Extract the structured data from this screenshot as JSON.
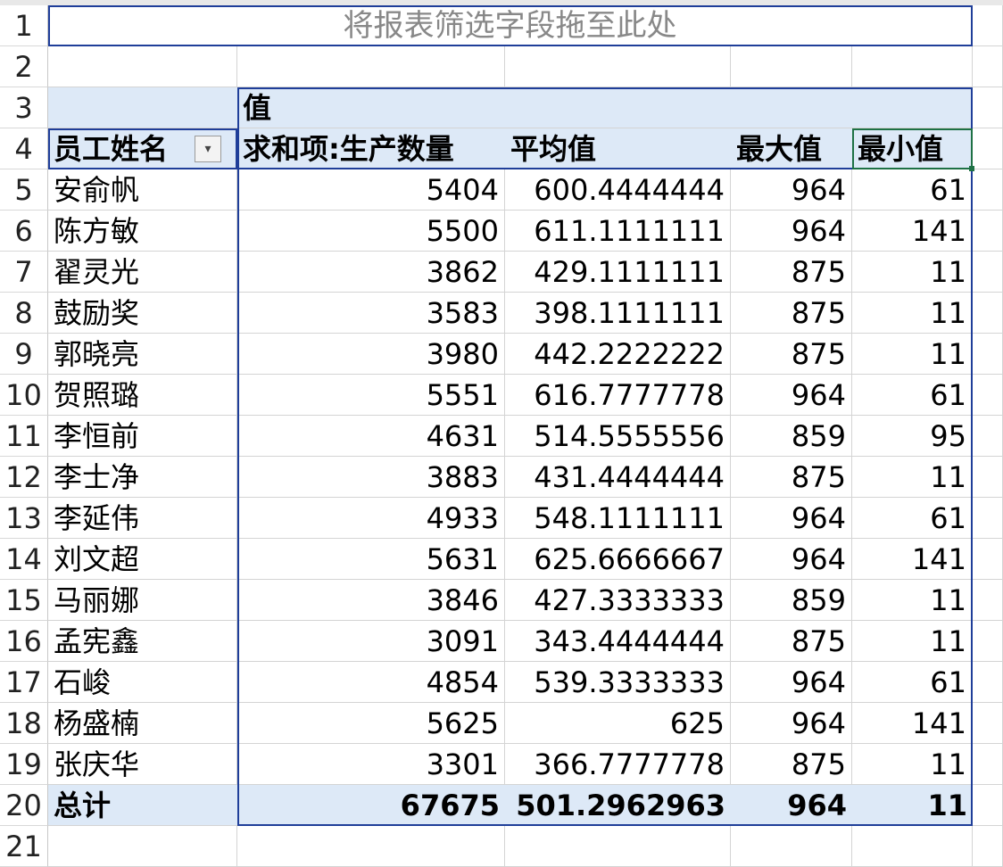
{
  "filter_area": {
    "text": "将报表筛选字段拖至此处"
  },
  "pivot": {
    "values_caption": "值",
    "row_header": "员工姓名",
    "columns": [
      "求和项:生产数量",
      "平均值",
      "最大值",
      "最小值"
    ],
    "rows": [
      {
        "name": "安俞帆",
        "sum": "5404",
        "avg": "600.4444444",
        "max": "964",
        "min": "61"
      },
      {
        "name": "陈方敏",
        "sum": "5500",
        "avg": "611.1111111",
        "max": "964",
        "min": "141"
      },
      {
        "name": "翟灵光",
        "sum": "3862",
        "avg": "429.1111111",
        "max": "875",
        "min": "11"
      },
      {
        "name": "鼓励奖",
        "sum": "3583",
        "avg": "398.1111111",
        "max": "875",
        "min": "11"
      },
      {
        "name": "郭晓亮",
        "sum": "3980",
        "avg": "442.2222222",
        "max": "875",
        "min": "11"
      },
      {
        "name": "贺照璐",
        "sum": "5551",
        "avg": "616.7777778",
        "max": "964",
        "min": "61"
      },
      {
        "name": "李恒前",
        "sum": "4631",
        "avg": "514.5555556",
        "max": "859",
        "min": "95"
      },
      {
        "name": "李士净",
        "sum": "3883",
        "avg": "431.4444444",
        "max": "875",
        "min": "11"
      },
      {
        "name": "李延伟",
        "sum": "4933",
        "avg": "548.1111111",
        "max": "964",
        "min": "61"
      },
      {
        "name": "刘文超",
        "sum": "5631",
        "avg": "625.6666667",
        "max": "964",
        "min": "141"
      },
      {
        "name": "马丽娜",
        "sum": "3846",
        "avg": "427.3333333",
        "max": "859",
        "min": "11"
      },
      {
        "name": "孟宪鑫",
        "sum": "3091",
        "avg": "343.4444444",
        "max": "875",
        "min": "11"
      },
      {
        "name": "石峻",
        "sum": "4854",
        "avg": "539.3333333",
        "max": "964",
        "min": "61"
      },
      {
        "name": "杨盛楠",
        "sum": "5625",
        "avg": "625",
        "max": "964",
        "min": "141"
      },
      {
        "name": "张庆华",
        "sum": "3301",
        "avg": "366.7777778",
        "max": "875",
        "min": "11"
      }
    ],
    "total": {
      "name": "总计",
      "sum": "67675",
      "avg": "501.2962963",
      "max": "964",
      "min": "11"
    }
  },
  "row_numbers": [
    "1",
    "2",
    "3",
    "4",
    "5",
    "6",
    "7",
    "8",
    "9",
    "10",
    "11",
    "12",
    "13",
    "14",
    "15",
    "16",
    "17",
    "18",
    "19",
    "20",
    "21"
  ],
  "colors": {
    "header_fill": "#dde9f7",
    "pivot_border": "#1f3e99",
    "selected_border": "#1e7145"
  },
  "icons": {
    "dropdown": "filter-dropdown-icon"
  }
}
